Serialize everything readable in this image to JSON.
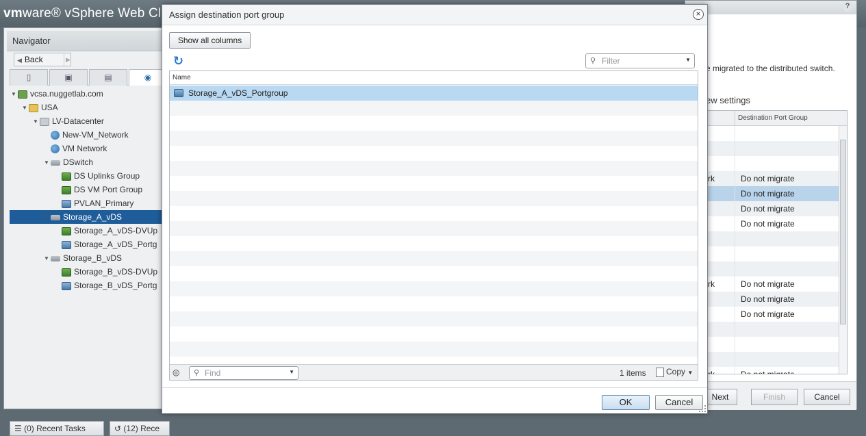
{
  "header": {
    "brand_vm": "vm",
    "brand_ware": "ware® vSphere Web Cli",
    "help": "?"
  },
  "navigator": {
    "title": "Navigator",
    "back_label": "Back",
    "tree": [
      {
        "label": "vcsa.nuggetlab.com",
        "icon": "vcenter-icon",
        "toggle": "▼"
      },
      {
        "label": "USA",
        "icon": "folder-icon",
        "toggle": "▼"
      },
      {
        "label": "LV-Datacenter",
        "icon": "datacenter-icon",
        "toggle": "▼"
      },
      {
        "label": "New-VM_Network",
        "icon": "network-icon",
        "toggle": ""
      },
      {
        "label": "VM Network",
        "icon": "network-icon",
        "toggle": ""
      },
      {
        "label": "DSwitch",
        "icon": "switch-icon",
        "toggle": "▼"
      },
      {
        "label": "DS Uplinks Group",
        "icon": "uplink-portgroup-icon",
        "toggle": ""
      },
      {
        "label": "DS VM Port Group",
        "icon": "uplink-portgroup-icon",
        "toggle": ""
      },
      {
        "label": "PVLAN_Primary",
        "icon": "portgroup-icon",
        "toggle": ""
      },
      {
        "label": "Storage_A_vDS",
        "icon": "switch-icon",
        "toggle": "▽",
        "selected": true
      },
      {
        "label": "Storage_A_vDS-DVUp",
        "icon": "uplink-portgroup-icon",
        "toggle": ""
      },
      {
        "label": "Storage_A_vDS_Portg",
        "icon": "portgroup-icon",
        "toggle": ""
      },
      {
        "label": "Storage_B_vDS",
        "icon": "switch-icon",
        "toggle": "▼"
      },
      {
        "label": "Storage_B_vDS-DVUp",
        "icon": "uplink-portgroup-icon",
        "toggle": ""
      },
      {
        "label": "Storage_B_vDS_Portg",
        "icon": "portgroup-icon",
        "toggle": ""
      }
    ],
    "recent_tasks": "(0)  Recent Tasks",
    "recent_objects": "(12)  Rece"
  },
  "wizard": {
    "description": "e migrated to the distributed switch.",
    "subtitle": "ew settings",
    "column_header": "Destination Port Group",
    "rows": [
      {
        "c1": "",
        "c2": ""
      },
      {
        "c1": "",
        "c2": ""
      },
      {
        "c1": "",
        "c2": ""
      },
      {
        "c1": "rk",
        "c2": "Do not migrate"
      },
      {
        "c1": "",
        "c2": "Do not migrate",
        "selected": true
      },
      {
        "c1": "",
        "c2": "Do not migrate"
      },
      {
        "c1": "",
        "c2": "Do not migrate"
      },
      {
        "c1": "",
        "c2": ""
      },
      {
        "c1": "",
        "c2": ""
      },
      {
        "c1": "",
        "c2": ""
      },
      {
        "c1": "rk",
        "c2": "Do not migrate"
      },
      {
        "c1": "",
        "c2": "Do not migrate"
      },
      {
        "c1": "",
        "c2": "Do not migrate"
      },
      {
        "c1": "",
        "c2": ""
      },
      {
        "c1": "",
        "c2": ""
      },
      {
        "c1": "",
        "c2": ""
      },
      {
        "c1": "rk",
        "c2": "Do not migrate"
      }
    ],
    "next_label": "Next",
    "finish_label": "Finish",
    "cancel_label": "Cancel"
  },
  "dialog": {
    "title": "Assign destination port group",
    "show_all_columns": "Show all columns",
    "filter_placeholder": "Filter",
    "column_name": "Name",
    "rows": [
      {
        "name": "Storage_A_vDS_Portgroup",
        "icon": "portgroup-icon",
        "selected": true
      }
    ],
    "find_placeholder": "Find",
    "items_count": "1 items",
    "copy_label": "Copy",
    "ok_label": "OK",
    "cancel_label": "Cancel"
  },
  "colors": {
    "selection": "#1f5d9a",
    "grid_selection": "#b9d9f2",
    "header_bg": "#5e6a72"
  }
}
